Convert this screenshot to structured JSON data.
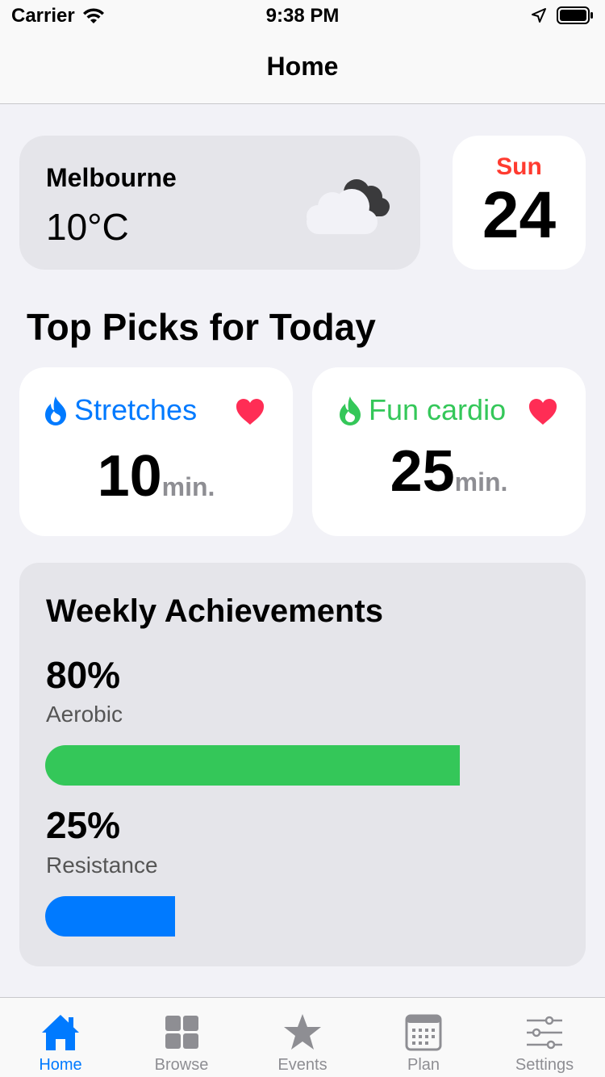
{
  "status_bar": {
    "carrier": "Carrier",
    "time": "9:38 PM"
  },
  "nav": {
    "title": "Home"
  },
  "weather": {
    "city": "Melbourne",
    "temperature": "10°C",
    "icon": "cloudy-icon"
  },
  "date": {
    "day": "Sun",
    "number": "24",
    "day_color": "#ff3b30"
  },
  "section": {
    "title": "Top Picks for Today"
  },
  "picks": [
    {
      "label": "Stretches",
      "value": "10",
      "unit": "min.",
      "color": "#007aff",
      "icon": "flame-icon",
      "favorite_icon": "heart-icon"
    },
    {
      "label": "Fun cardio",
      "value": "25",
      "unit": "min.",
      "color": "#34c759",
      "icon": "flame-icon",
      "favorite_icon": "heart-icon"
    }
  ],
  "achievements": {
    "title": "Weekly Achievements",
    "items": [
      {
        "percent_text": "80%",
        "label": "Aerobic",
        "fraction": 0.8,
        "color": "#34c759"
      },
      {
        "percent_text": "25%",
        "label": "Resistance",
        "fraction": 0.25,
        "color": "#007aff"
      }
    ]
  },
  "tabs": [
    {
      "label": "Home",
      "icon": "house-icon",
      "active": true
    },
    {
      "label": "Browse",
      "icon": "grid-icon",
      "active": false
    },
    {
      "label": "Events",
      "icon": "star-icon",
      "active": false
    },
    {
      "label": "Plan",
      "icon": "calendar-icon",
      "active": false
    },
    {
      "label": "Settings",
      "icon": "sliders-icon",
      "active": false
    }
  ],
  "colors": {
    "accent": "#007aff",
    "heart": "#ff2d55",
    "inactive": "#8e8e93"
  }
}
